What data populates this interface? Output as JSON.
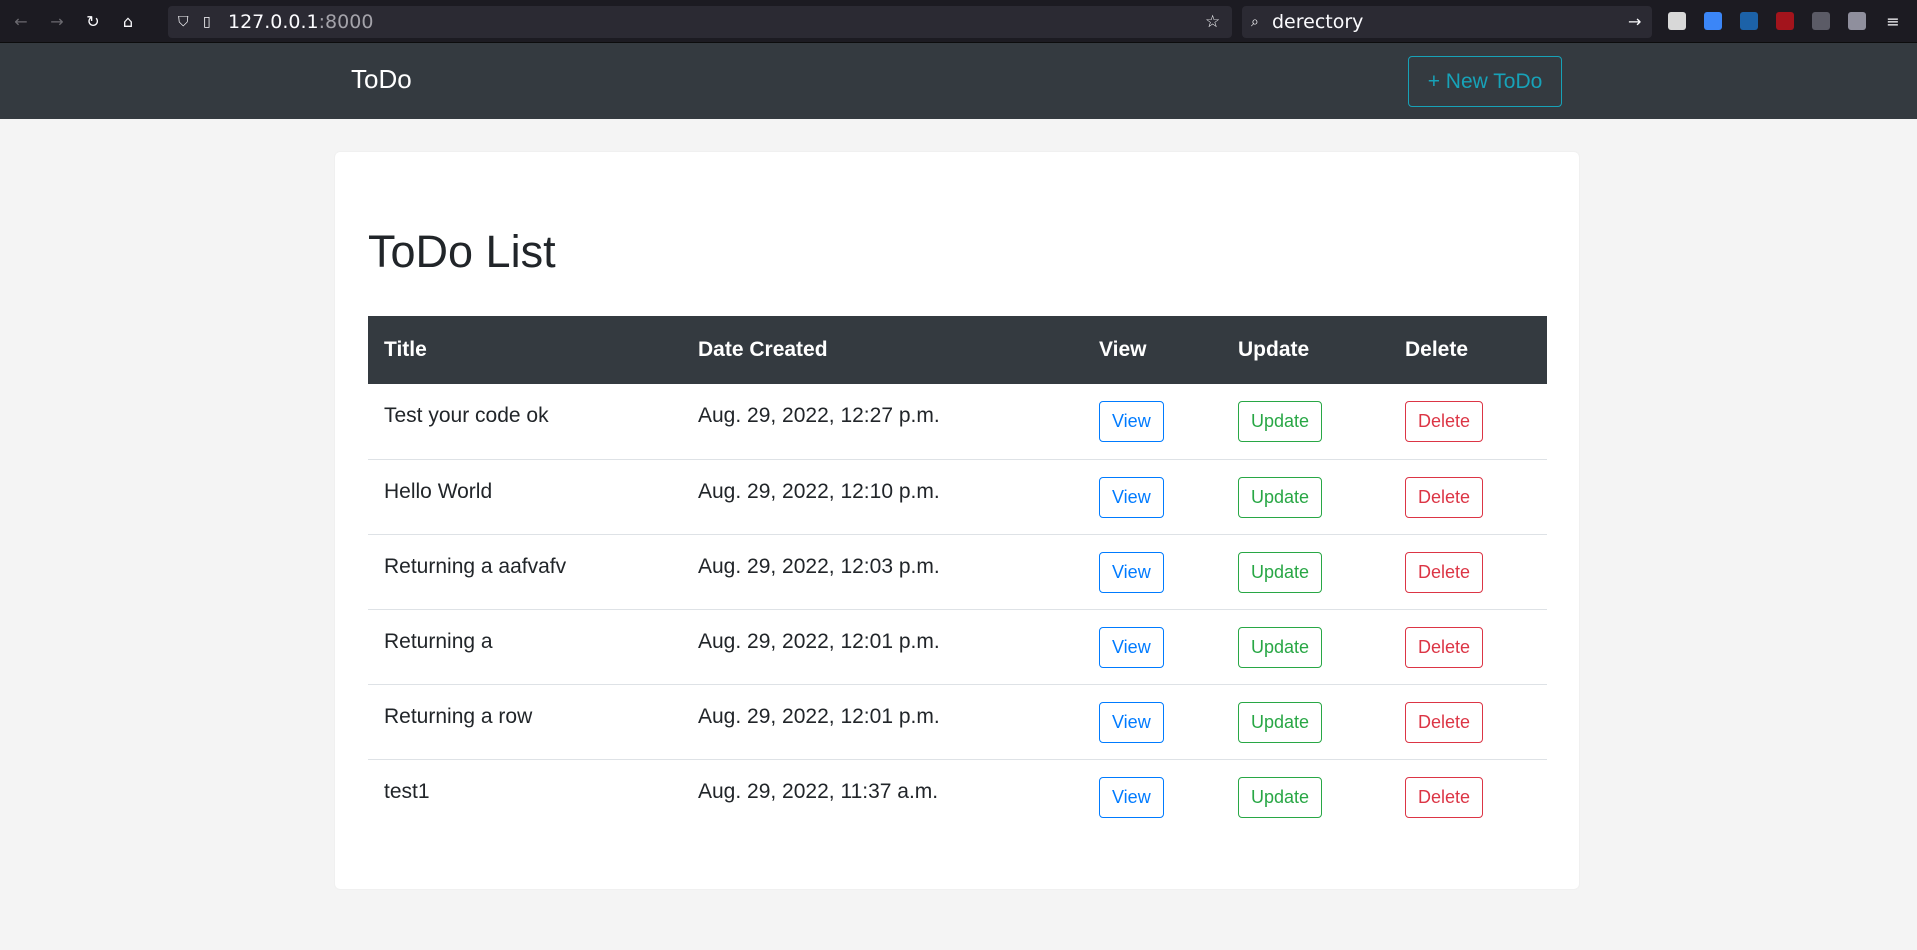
{
  "browser": {
    "url_host": "127.0.0.1",
    "url_port": ":8000",
    "search_text": "derectory"
  },
  "navbar": {
    "brand": "ToDo",
    "new_todo_label": "+ New ToDo"
  },
  "main": {
    "title": "ToDo List",
    "columns": [
      "Title",
      "Date Created",
      "View",
      "Update",
      "Delete"
    ],
    "rows": [
      {
        "title": "Test your code ok",
        "date": "Aug. 29, 2022, 12:27 p.m.",
        "view": "View",
        "update": "Update",
        "delete": "Delete"
      },
      {
        "title": "Hello World",
        "date": "Aug. 29, 2022, 12:10 p.m.",
        "view": "View",
        "update": "Update",
        "delete": "Delete"
      },
      {
        "title": "Returning a aafvafv",
        "date": "Aug. 29, 2022, 12:03 p.m.",
        "view": "View",
        "update": "Update",
        "delete": "Delete"
      },
      {
        "title": "Returning a",
        "date": "Aug. 29, 2022, 12:01 p.m.",
        "view": "View",
        "update": "Update",
        "delete": "Delete"
      },
      {
        "title": "Returning a row",
        "date": "Aug. 29, 2022, 12:01 p.m.",
        "view": "View",
        "update": "Update",
        "delete": "Delete"
      },
      {
        "title": "test1",
        "date": "Aug. 29, 2022, 11:37 a.m.",
        "view": "View",
        "update": "Update",
        "delete": "Delete"
      }
    ]
  },
  "colors": {
    "navbar_bg": "#343a40",
    "accent_info": "#17a2b8",
    "primary": "#007bff",
    "success": "#28a745",
    "danger": "#dc3545"
  }
}
